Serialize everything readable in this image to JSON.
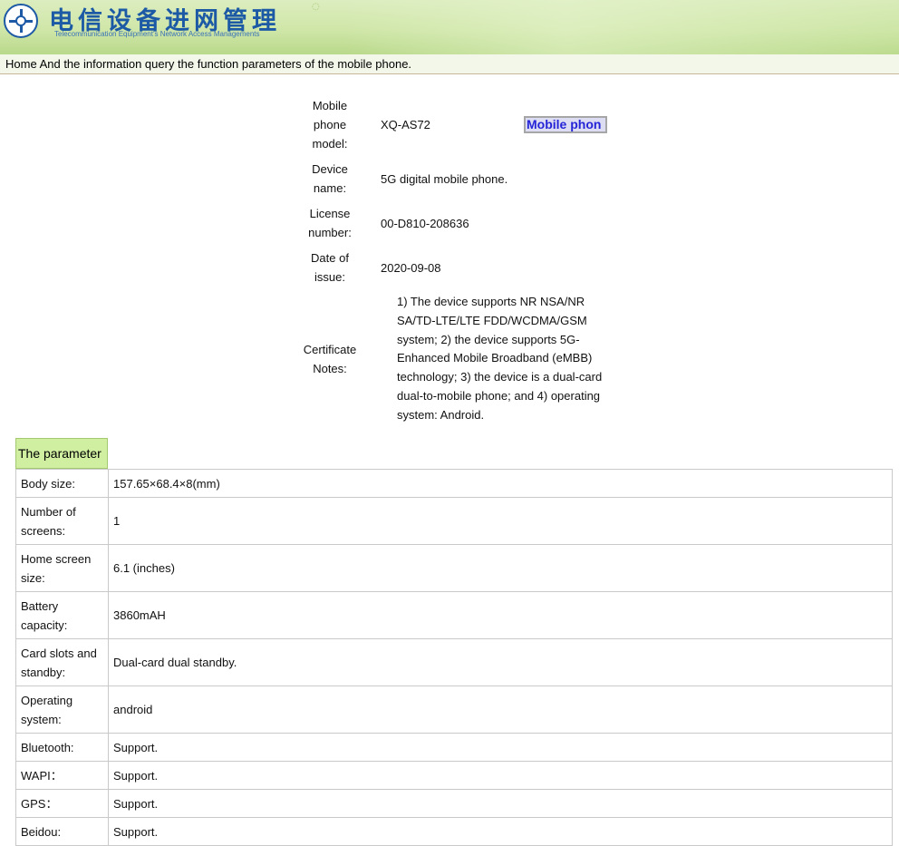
{
  "header": {
    "title": "电信设备进网管理",
    "subtitle": "Telecommunication Equipment's Network Access Managements",
    "colors": {
      "title": "#1d5aa6",
      "banner": "#cfe6a8"
    }
  },
  "breadcrumb": "Home And the information query the function parameters of the mobile phone.",
  "info": {
    "model": {
      "label": "Mobile phone model:",
      "value": "XQ-AS72",
      "button": "Mobile phon"
    },
    "device": {
      "label": "Device name:",
      "value": "5G digital mobile phone."
    },
    "license": {
      "label": "License number:",
      "value": "00-D810-208636"
    },
    "date": {
      "label": "Date of issue:",
      "value": "2020-09-08"
    },
    "notes": {
      "label": "Certificate Notes:",
      "value": "1) The device supports NR NSA/NR SA/TD-LTE/LTE FDD/WCDMA/GSM system; 2) the device supports 5G-Enhanced Mobile Broadband (eMBB) technology; 3) the device is a dual-card dual-to-mobile phone; and 4) operating system: Android."
    }
  },
  "params": {
    "tab_label": "The parameter",
    "rows": [
      {
        "label": "Body size:",
        "value": "157.65×68.4×8(mm)"
      },
      {
        "label": "Number of screens:",
        "value": "1"
      },
      {
        "label": "Home screen size:",
        "value": "6.1 (inches)"
      },
      {
        "label": "Battery capacity:",
        "value": "3860mAH"
      },
      {
        "label": "Card slots and standby:",
        "value": "Dual-card dual standby."
      },
      {
        "label": "Operating system:",
        "value": "android"
      },
      {
        "label": "Bluetooth:",
        "value": "Support."
      },
      {
        "label": "WAPI：",
        "value": "Support."
      },
      {
        "label": "GPS：",
        "value": "Support."
      },
      {
        "label": "Beidou:",
        "value": "Support."
      }
    ]
  }
}
